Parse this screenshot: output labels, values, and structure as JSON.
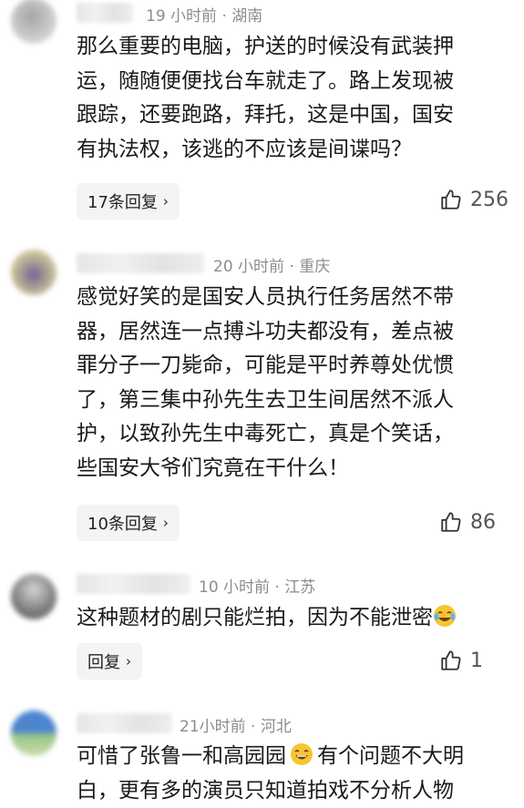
{
  "comments": [
    {
      "time": "19 小时前",
      "location": "湖南",
      "lines": [
        "那么重要的电脑，护送的时候没有武装押",
        "运，随随便便找台车就走了。路上发现被",
        "跟踪，还要跑路，拜托，这是中国，国安",
        "有执法权，该逃的不应该是间谍吗？"
      ],
      "reply_label": "17条回复",
      "likes": "256"
    },
    {
      "time": "20 小时前",
      "location": "重庆",
      "lines": [
        "感觉好笑的是国安人员执行任务居然不带",
        "器，居然连一点搏斗功夫都没有，差点被",
        "罪分子一刀毙命，可能是平时养尊处优惯",
        "了，第三集中孙先生去卫生间居然不派人",
        "护，以致孙先生中毒死亡，真是个笑话，",
        "些国安大爷们究竟在干什么！"
      ],
      "reply_label": "10条回复",
      "likes": "86"
    },
    {
      "time": "10 小时前",
      "location": "江苏",
      "lines": [
        "这种题材的剧只能烂拍，因为不能泄密"
      ],
      "reply_label": "回复",
      "likes": "1"
    },
    {
      "time": "21小时前",
      "location": "河北",
      "lines": [
        "可惜了张鲁一和高园园",
        "有个问题不大明",
        "白，更有多的演员只知道拍戏不分析人物"
      ],
      "reply_label": "",
      "likes": ""
    }
  ],
  "separator": " · ",
  "icons": {
    "like": "thumbs-up-icon",
    "chevron": "chevron-right-icon",
    "emoji_cry_laugh": "laughing-crying-emoji-icon",
    "emoji_grin": "grinning-emoji-icon"
  },
  "colors": {
    "meta": "#8c8c8c",
    "reply_bg": "#f4f4f4",
    "text": "#1a1a1a"
  }
}
